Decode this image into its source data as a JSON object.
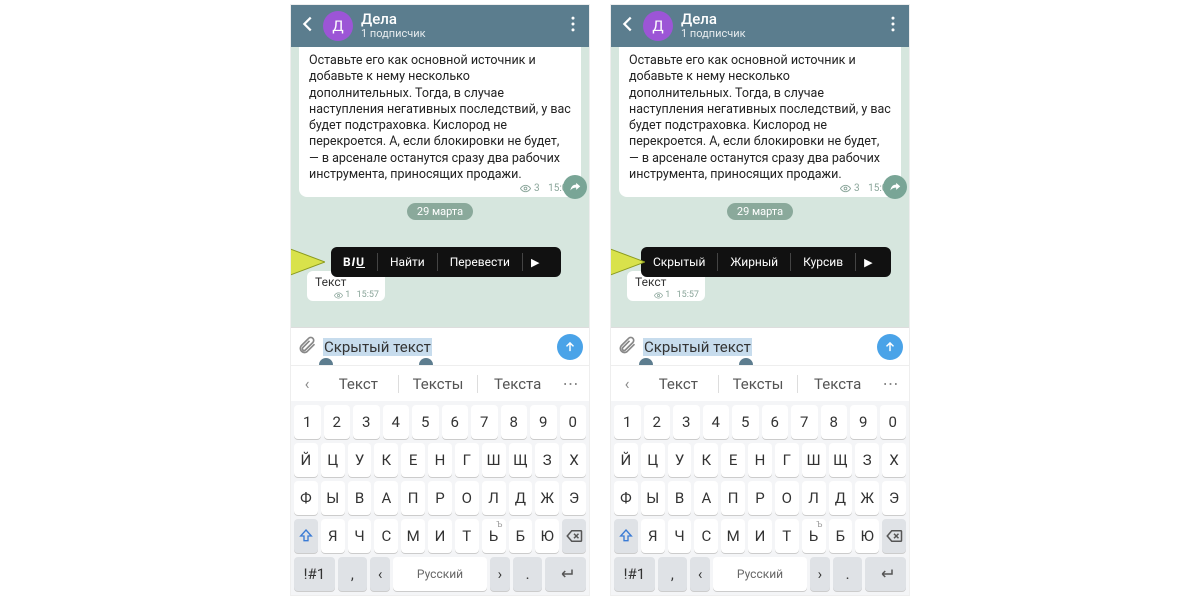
{
  "header": {
    "avatar_letter": "Д",
    "channel_name": "Дела",
    "subscribers": "1 подписчик"
  },
  "message": {
    "body": "Оставьте его как основной источник и добавьте к нему несколько дополнительных. Тогда, в случае наступления негативных последствий, у вас будет подстраховка. Кислород не перекроется. А, если блокировки не будет, — в арсенале останутся сразу два рабочих инструмента, приносящих продажи.",
    "views": "3",
    "time": "15:02"
  },
  "date_separator": "29 марта",
  "small_msg": {
    "text": "Текст",
    "views": "1",
    "time": "15:57"
  },
  "context_menu_left": {
    "biu": "BIU",
    "find": "Найти",
    "translate": "Перевести"
  },
  "context_menu_right": {
    "hidden": "Скрытый",
    "bold": "Жирный",
    "italic": "Курсив"
  },
  "input_text": "Скрытый текст",
  "suggestions": {
    "s1": "Текст",
    "s2": "Тексты",
    "s3": "Текста"
  },
  "keyboard": {
    "row1": [
      "1",
      "2",
      "3",
      "4",
      "5",
      "6",
      "7",
      "8",
      "9",
      "0"
    ],
    "row2": [
      "Й",
      "Ц",
      "У",
      "К",
      "Е",
      "Н",
      "Г",
      "Ш",
      "Щ",
      "З",
      "Х"
    ],
    "row3": [
      "Ф",
      "Ы",
      "В",
      "А",
      "П",
      "Р",
      "О",
      "Л",
      "Д",
      "Ж",
      "Э"
    ],
    "row4": [
      "Я",
      "Ч",
      "С",
      "М",
      "И",
      "Т",
      "Ь",
      "Б",
      "Ю"
    ],
    "row4_sup": [
      "",
      "",
      "",
      "",
      "",
      "",
      "Ъ",
      "",
      ""
    ],
    "sym": "!#1",
    "comma": ",",
    "lang": "Русский",
    "dot": "."
  }
}
